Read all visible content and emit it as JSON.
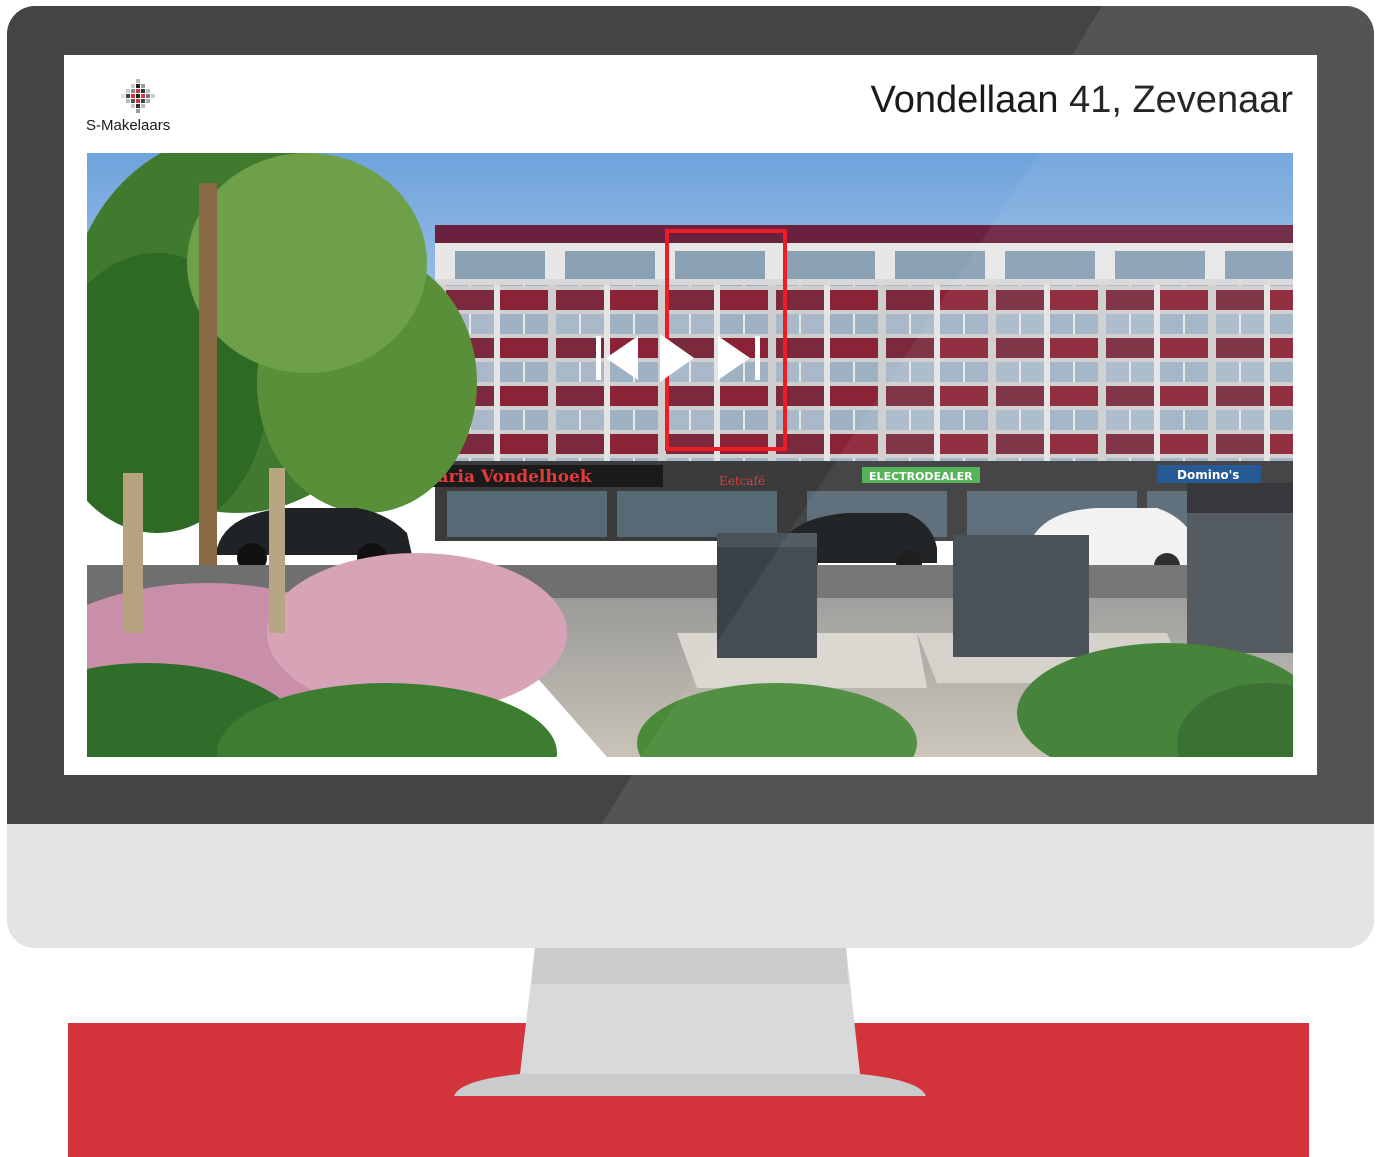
{
  "brand": {
    "name": "S-Makelaars",
    "accent_color": "#d3333a"
  },
  "listing": {
    "address": "Vondellaan 41, Zevenaar"
  },
  "player": {
    "prev_icon": "skip-previous-icon",
    "play_icon": "play-icon",
    "next_icon": "skip-next-icon"
  },
  "photo_signs": {
    "shop_1": "Cafetaria Vondelhoek",
    "shop_2": "Eetcafé",
    "shop_3": "ELECTRODEALER",
    "shop_4": "Domino's"
  }
}
